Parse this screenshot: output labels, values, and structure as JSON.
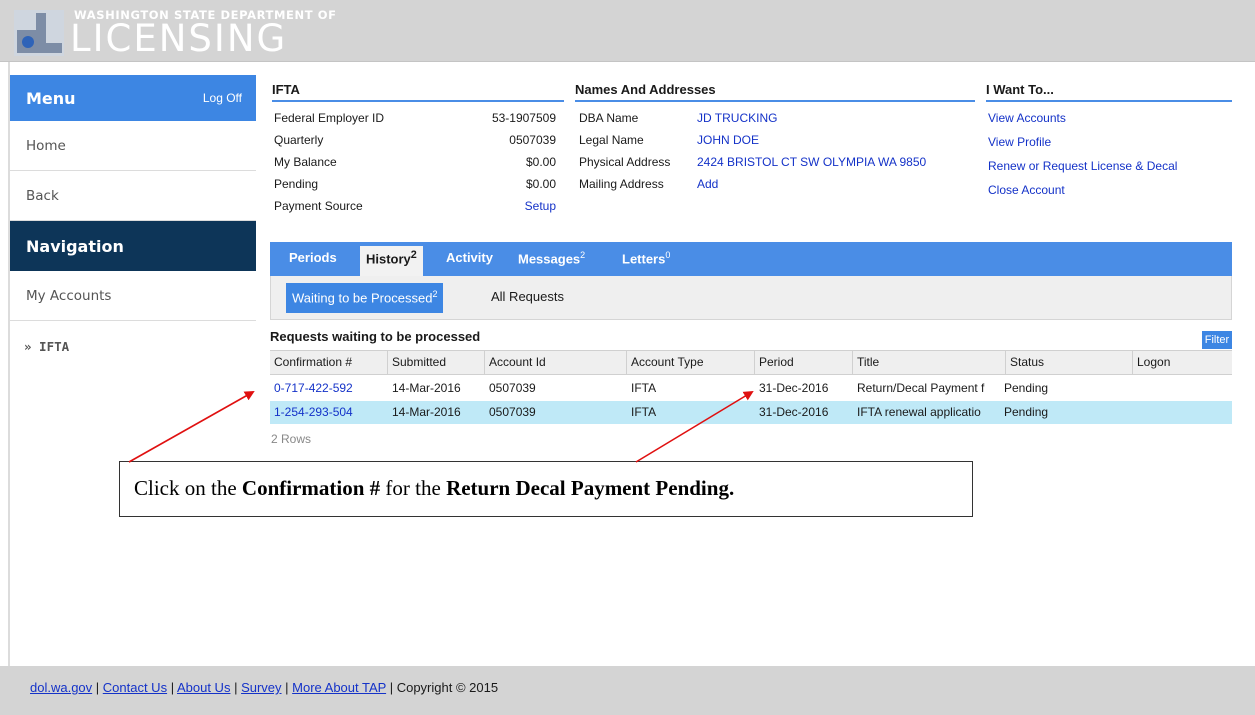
{
  "header": {
    "agency_small": "WASHINGTON STATE DEPARTMENT OF",
    "agency_big": "LICENSING"
  },
  "sidebar": {
    "menu_title": "Menu",
    "logoff": "Log Off",
    "home": "Home",
    "back": "Back",
    "navigation": "Navigation",
    "my_accounts": "My Accounts",
    "ifta": "» IFTA"
  },
  "ifta": {
    "title": "IFTA",
    "fields": [
      {
        "label": "Federal Employer ID",
        "value": "53-1907509"
      },
      {
        "label": "Quarterly",
        "value": "0507039"
      },
      {
        "label": "My Balance",
        "value": "$0.00"
      },
      {
        "label": "Pending",
        "value": "$0.00"
      },
      {
        "label": "Payment Source",
        "value": "Setup"
      }
    ]
  },
  "names": {
    "title": "Names And Addresses",
    "fields": [
      {
        "label": "DBA Name",
        "value": "JD TRUCKING"
      },
      {
        "label": "Legal Name",
        "value": "JOHN DOE"
      },
      {
        "label": "Physical Address",
        "value": "2424 BRISTOL CT SW OLYMPIA WA 9850"
      },
      {
        "label": "Mailing Address",
        "value": "Add"
      }
    ]
  },
  "iwant": {
    "title": "I Want To...",
    "links": [
      "View Accounts",
      "View Profile",
      "Renew or Request License & Decal",
      "Close Account"
    ]
  },
  "tabs": {
    "periods": "Periods",
    "history": "History",
    "history_count": "2",
    "activity": "Activity",
    "messages": "Messages",
    "messages_count": "2",
    "letters": "Letters",
    "letters_count": "0"
  },
  "subtabs": {
    "waiting": "Waiting to be Processed",
    "waiting_count": "2",
    "all": "All Requests"
  },
  "requests": {
    "title": "Requests waiting to be processed",
    "filter": "Filter",
    "columns": [
      "Confirmation #",
      "Submitted",
      "Account Id",
      "Account Type",
      "Period",
      "Title",
      "Status",
      "Logon"
    ],
    "rows": [
      [
        "0-717-422-592",
        "14-Mar-2016",
        "0507039",
        "IFTA",
        "31-Dec-2016",
        "Return/Decal Payment f",
        "Pending",
        ""
      ],
      [
        "1-254-293-504",
        "14-Mar-2016",
        "0507039",
        "IFTA",
        "31-Dec-2016",
        "IFTA renewal applicatio",
        "Pending",
        ""
      ]
    ],
    "row_count": "2 Rows"
  },
  "callout": {
    "part1": "Click on the ",
    "bold1": "Confirmation #",
    "part2": " for the ",
    "bold2": "Return Decal Payment Pending."
  },
  "footer": {
    "links": [
      "dol.wa.gov",
      "Contact Us",
      "About Us",
      "Survey",
      "More About TAP"
    ],
    "separator": " | ",
    "copyright": "Copyright © 2015"
  },
  "colors": {
    "accent_blue": "#3d86e3",
    "nav_dark": "#0d3558",
    "link": "#1432c8",
    "selected_row": "#bfe9f7",
    "arrow": "#e01010"
  }
}
